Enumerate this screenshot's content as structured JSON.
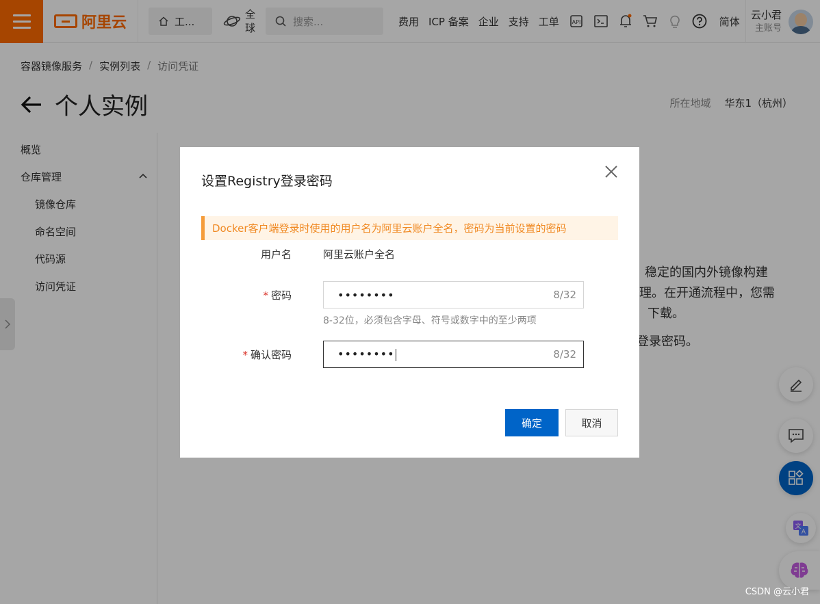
{
  "topbar": {
    "logo_text": "阿里云",
    "workbench_label": "工...",
    "globe_line1": "全",
    "globe_line2": "球",
    "search_placeholder": "搜索...",
    "nav": [
      "费用",
      "ICP 备案",
      "企业",
      "支持",
      "工单"
    ],
    "lang": "简体",
    "user_name": "云小君",
    "user_sub": "主账号",
    "brand_color": "#ff6a00"
  },
  "breadcrumb": [
    "容器镜像服务",
    "实例列表",
    "访问凭证"
  ],
  "page_title": "个人实例",
  "region": {
    "label": "所在地域",
    "value": "华东1（杭州）"
  },
  "sidebar": {
    "overview": "概览",
    "repo_mgmt": "仓库管理",
    "items": [
      "镜像仓库",
      "命名空间",
      "代码源",
      "访问凭证"
    ]
  },
  "background_text": [
    "力，稳定的国内外镜像构建",
    "理。在开通流程中，您需",
    "下载。",
    "登录密码。"
  ],
  "dialog": {
    "title": "设置Registry登录密码",
    "alert": "Docker客户端登录时使用的用户名为阿里云账户全名，密码为当前设置的密码",
    "username_label": "用户名",
    "username_value": "阿里云账户全名",
    "password_label": "密码",
    "password_value": "••••••••",
    "password_count": "8/32",
    "password_hint": "8-32位，必须包含字母、符号或数字中的至少两项",
    "confirm_label": "确认密码",
    "confirm_value": "••••••••",
    "confirm_count": "8/32",
    "ok_button": "确定",
    "cancel_button": "取消",
    "accent_color": "#0064c8"
  },
  "watermark": "CSDN @云小君"
}
